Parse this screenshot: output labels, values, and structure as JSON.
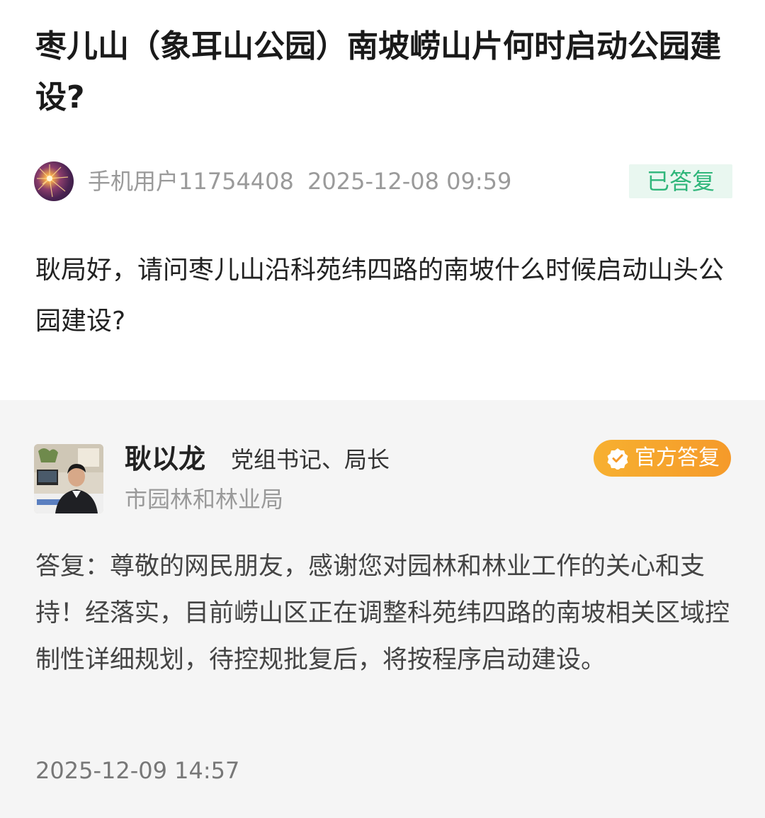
{
  "question": {
    "title": "枣儿山（象耳山公园）南坡崂山片何时启动公园建设?",
    "asker": {
      "name": "手机用户11754408",
      "time": "2025-12-08 09:59",
      "avatar": "avatar-icon"
    },
    "status": "已答复",
    "body": "耿局好，请问枣儿山沿科苑纬四路的南坡什么时候启动山头公园建设?"
  },
  "answer": {
    "responder": {
      "name": "耿以龙",
      "title": "党组书记、局长",
      "department": "市园林和林业局",
      "photo": "person-photo"
    },
    "badge": {
      "label": "官方答复",
      "icon": "verified-shield-icon"
    },
    "body": "答复：尊敬的网民朋友，感谢您对园林和林业工作的关心和支持！经落实，目前崂山区正在调整科苑纬四路的南坡相关区域控制性详细规划，待控规批复后，将按程序启动建设。",
    "time": "2025-12-09 14:57"
  },
  "colors": {
    "status_green": "#2fb67a",
    "status_green_bg": "#e9f7f0",
    "official_orange": "#f7a72d",
    "answer_bg": "#f5f5f5"
  }
}
